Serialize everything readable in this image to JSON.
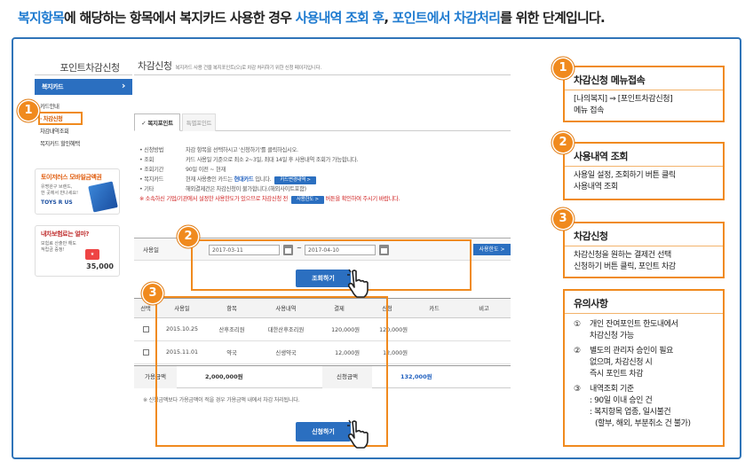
{
  "headline": {
    "part1": "복지항목",
    "part2": "에 해당하는 항목에서 복지카드 사용한 경우 ",
    "part3": "사용내역 조회 후",
    "part4": ", ",
    "part5": "포인트에서 차감처리",
    "part6": "를 위한 단계입니다."
  },
  "sidebar": {
    "title": "포인트차감신청",
    "section": "복지카드",
    "items": [
      "카드안내",
      "차감신청",
      "차감내역조회",
      "복지카드 할인혜택"
    ],
    "active_index": 1,
    "ad1": {
      "title": "토이저러스 모바일금액권",
      "desc1": "유명완구 브랜드,",
      "desc2": "한 곳에서 만나세요!",
      "logo": "TOYS R US"
    },
    "ad2": {
      "title": "내차보험료는 얼마?",
      "desc1": "보험료 산출만 해도",
      "desc2": "적립금 증정!",
      "amount": "35,000"
    }
  },
  "main": {
    "title": "차감신청",
    "subtitle": "복지카드 사용 건을 복지포인트(으)로 차감 처리하기 위한 신청 페이지입니다.",
    "tabs": [
      "복지포인트",
      "특별포인트"
    ],
    "info": [
      {
        "label": "신청방법",
        "text": "차감 항목을 선택하시고 '신청하기'를 클릭하십시오."
      },
      {
        "label": "조회",
        "text": "카드 사용일 기준으로 최소 2~3일, 최대 14일 후 사용내역 조회가 가능합니다."
      },
      {
        "label": "조회기간",
        "text": "90일 이전 ~ 현재"
      },
      {
        "label": "복지카드",
        "text": "현재 사용중인 카드는",
        "highlight": "현대카드",
        "text2": "입니다.",
        "button": "카드변경내역 >"
      },
      {
        "label": "기타",
        "text": "해외결제건은 차감신청이 불가합니다.(해외사이트포함)"
      }
    ],
    "warning": {
      "text": "※ 소속하신 기업/기관에서 설정한 사용한도가 있으므로 차감신청 전",
      "button": "사용한도 >",
      "text2": "버튼을 확인하여 주시기 바랍니다."
    },
    "search": {
      "label": "사용일",
      "date_from": "2017-03-11",
      "date_to": "2017-04-10",
      "limit_button": "사용한도 >"
    },
    "search_button": "조회하기",
    "table": {
      "headers": [
        "선택",
        "사용일",
        "항목",
        "사용내역",
        "결제",
        "신청",
        "카드",
        "비고"
      ],
      "rows": [
        [
          "",
          "2015.10.25",
          "산후조리원",
          "대한산후조리원",
          "120,000원",
          "120,000원",
          "",
          ""
        ],
        [
          "",
          "2015.11.01",
          "약국",
          "신생약국",
          "12,000원",
          "12,000원",
          "",
          ""
        ]
      ]
    },
    "summary": {
      "label1": "가용금액",
      "value1": "2,000,000원",
      "label2": "신청금액",
      "value2": "132,000원"
    },
    "note": "※ 신청금액보다 가용금액이 적을 경우 가용금액 내에서 차감 처리됩니다.",
    "apply_button": "신청하기"
  },
  "markers": [
    "1",
    "2",
    "3"
  ],
  "panels": [
    {
      "num": "1",
      "title": "차감신청 메뉴접속",
      "lines": [
        "[나의복지] ⇒ [포인트차감신청]",
        "메뉴 접속"
      ]
    },
    {
      "num": "2",
      "title": "사용내역 조회",
      "lines": [
        "사용일 설정, 조회하기 버튼 클릭",
        "사용내역 조회"
      ]
    },
    {
      "num": "3",
      "title": "차감신청",
      "lines": [
        "차감신청을 원하는 결제건 선택",
        "신청하기 버튼 클릭, 포인트 차감"
      ]
    },
    {
      "title": "유의사항",
      "items": [
        {
          "n": "①",
          "lines": [
            "개인 잔여포인트 한도내에서",
            "차감신청 가능"
          ]
        },
        {
          "n": "②",
          "lines": [
            "별도의 관리자 승인이 필요",
            "없으며, 차감신청 시",
            "즉시 포인트 차감"
          ]
        },
        {
          "n": "③",
          "lines": [
            "내역조회 기준",
            ": 90일 이내 승인 건",
            ": 복지항목 업종, 일시불건",
            "(할부, 해외, 부분취소 건 불가)"
          ]
        }
      ]
    }
  ],
  "colors": {
    "accent_blue": "#2b6fc0",
    "highlight_orange": "#f08a1e",
    "frame_blue": "#2f74b8",
    "text_blue": "#1f7bd0"
  }
}
